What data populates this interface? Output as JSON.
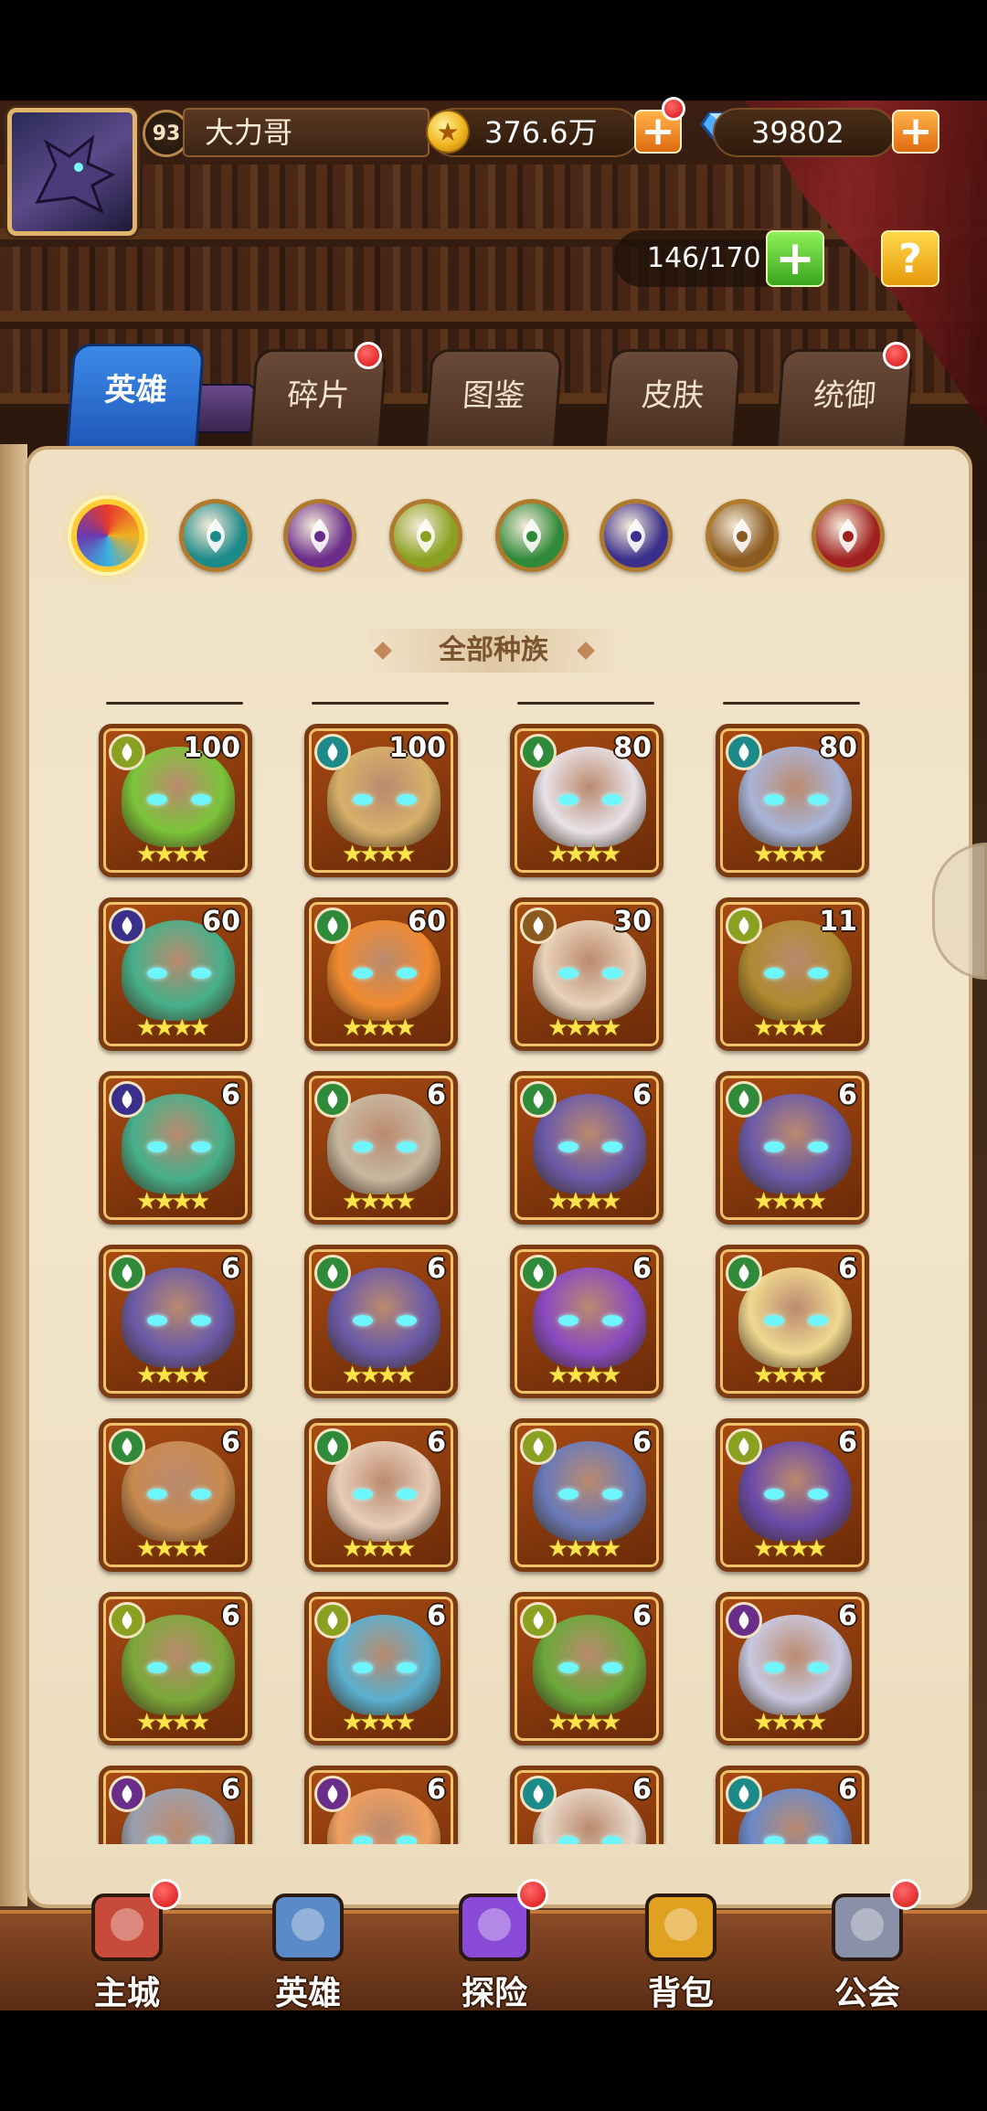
{
  "header": {
    "level": "93",
    "player_name": "大力哥",
    "gold": "376.6万",
    "gems": "39802",
    "plus": "+",
    "capacity": "146/170",
    "help": "?"
  },
  "tabs": [
    {
      "label": "英雄",
      "active": true
    },
    {
      "label": "碎片",
      "active": false
    },
    {
      "label": "图鉴",
      "active": false
    },
    {
      "label": "皮肤",
      "active": false
    },
    {
      "label": "统御",
      "active": false
    }
  ],
  "race_filter": {
    "title": "全部种族",
    "icons": [
      "all-races-icon",
      "water-race-icon",
      "mystic-race-icon",
      "forest-race-icon",
      "nature-race-icon",
      "shadow-race-icon",
      "light-race-icon",
      "fire-race-icon"
    ],
    "colors": [
      "#e85b2b",
      "#1d8a8a",
      "#6b2d8a",
      "#8aa020",
      "#2f8a3a",
      "#3a2f8a",
      "#8a5a20",
      "#a02020"
    ]
  },
  "heroes": [
    {
      "level": "100",
      "race": "forest",
      "stars": "★★★★",
      "bg": "#7cc43a"
    },
    {
      "level": "100",
      "race": "water",
      "stars": "★★★★",
      "bg": "#d8b06a"
    },
    {
      "level": "80",
      "race": "nature",
      "stars": "★★★★",
      "bg": "#e8e2e8"
    },
    {
      "level": "80",
      "race": "water",
      "stars": "★★★★",
      "bg": "#a8b4d8"
    },
    {
      "level": "60",
      "race": "shadow",
      "stars": "★★★★",
      "bg": "#46b08a"
    },
    {
      "level": "60",
      "race": "nature",
      "stars": "★★★★",
      "bg": "#f08a30"
    },
    {
      "level": "30",
      "race": "light",
      "stars": "★★★★",
      "bg": "#e8d2b8"
    },
    {
      "level": "11",
      "race": "forest",
      "stars": "★★★★",
      "bg": "#b08a30"
    },
    {
      "level": "6",
      "race": "shadow",
      "stars": "★★★★",
      "bg": "#46b08a"
    },
    {
      "level": "6",
      "race": "nature",
      "stars": "★★★★",
      "bg": "#c8b8a0"
    },
    {
      "level": "6",
      "race": "nature",
      "stars": "★★★★",
      "bg": "#6a5aa8"
    },
    {
      "level": "6",
      "race": "nature",
      "stars": "★★★★",
      "bg": "#6a5aa8"
    },
    {
      "level": "6",
      "race": "nature",
      "stars": "★★★★",
      "bg": "#6a5aa8"
    },
    {
      "level": "6",
      "race": "nature",
      "stars": "★★★★",
      "bg": "#6a5aa8"
    },
    {
      "level": "6",
      "race": "nature",
      "stars": "★★★★",
      "bg": "#8a4ac0"
    },
    {
      "level": "6",
      "race": "nature",
      "stars": "★★★★",
      "bg": "#f0d890"
    },
    {
      "level": "6",
      "race": "nature",
      "stars": "★★★★",
      "bg": "#c88a50"
    },
    {
      "level": "6",
      "race": "nature",
      "stars": "★★★★",
      "bg": "#e8cdb8"
    },
    {
      "level": "6",
      "race": "forest",
      "stars": "★★★★",
      "bg": "#6a7ab8"
    },
    {
      "level": "6",
      "race": "forest",
      "stars": "★★★★",
      "bg": "#6a4aa8"
    },
    {
      "level": "6",
      "race": "forest",
      "stars": "★★★★",
      "bg": "#7ca83a"
    },
    {
      "level": "6",
      "race": "forest",
      "stars": "★★★★",
      "bg": "#5ab0d0"
    },
    {
      "level": "6",
      "race": "forest",
      "stars": "★★★★",
      "bg": "#6aa83a"
    },
    {
      "level": "6",
      "race": "mystic",
      "stars": "★★★★",
      "bg": "#c8c8e0"
    },
    {
      "level": "6",
      "race": "mystic",
      "stars": "★★★★",
      "bg": "#9aa0b0"
    },
    {
      "level": "6",
      "race": "mystic",
      "stars": "★★★★",
      "bg": "#f0a060"
    },
    {
      "level": "6",
      "race": "water",
      "stars": "★★★★",
      "bg": "#e8d8c8"
    },
    {
      "level": "6",
      "race": "water",
      "stars": "★★★★",
      "bg": "#6a8ac8"
    }
  ],
  "nav": [
    {
      "label": "主城",
      "icon": "castle-icon",
      "badge": true
    },
    {
      "label": "英雄",
      "icon": "hero-icon",
      "badge": false
    },
    {
      "label": "探险",
      "icon": "portal-icon",
      "badge": true
    },
    {
      "label": "背包",
      "icon": "backpack-icon",
      "badge": false
    },
    {
      "label": "公会",
      "icon": "guild-icon",
      "badge": true
    }
  ]
}
